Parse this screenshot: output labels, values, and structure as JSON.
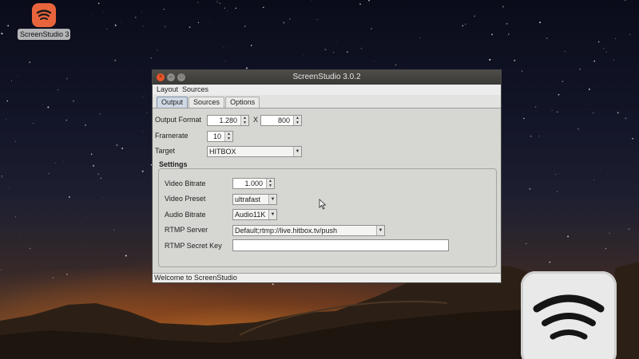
{
  "desktop": {
    "icon_label": "ScreenStudio 3"
  },
  "window": {
    "title": "ScreenStudio 3.0.2",
    "menu": [
      "Layout",
      "Sources"
    ],
    "tabs": [
      "Output",
      "Sources",
      "Options"
    ],
    "active_tab": "Output"
  },
  "output": {
    "format_label": "Output Format",
    "width": "1.280",
    "by": "X",
    "height": "800",
    "framerate_label": "Framerate",
    "framerate": "10",
    "target_label": "Target",
    "target": "HITBOX"
  },
  "settings": {
    "title": "Settings",
    "video_bitrate_label": "Video Bitrate",
    "video_bitrate": "1.000",
    "video_preset_label": "Video Preset",
    "video_preset": "ultrafast",
    "audio_bitrate_label": "Audio Bitrate",
    "audio_bitrate": "Audio11K",
    "rtmp_server_label": "RTMP Server",
    "rtmp_server": "Default;rtmp://live.hitbox.tv/push",
    "rtmp_key_label": "RTMP Secret Key",
    "rtmp_key": ""
  },
  "status": "Welcome to ScreenStudio",
  "colors": {
    "logo": "#e8643c",
    "titlebar": "#3f3e3a",
    "close_button": "#e9552c"
  }
}
